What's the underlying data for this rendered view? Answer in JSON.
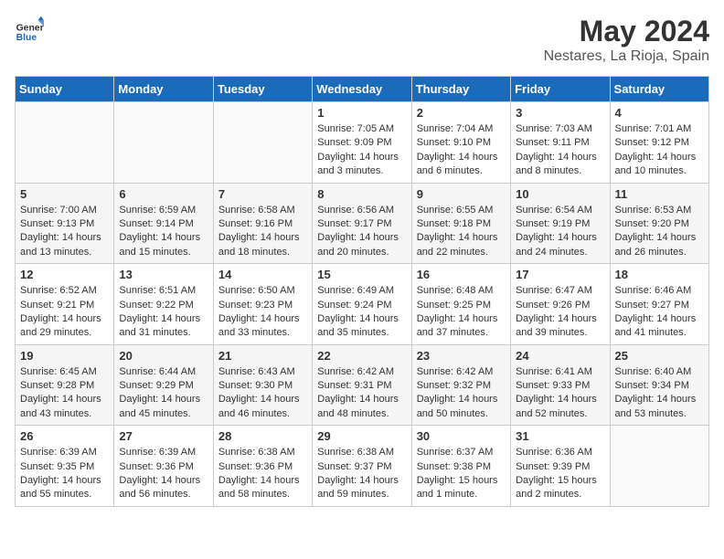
{
  "logo": {
    "text_general": "General",
    "text_blue": "Blue"
  },
  "header": {
    "title": "May 2024",
    "subtitle": "Nestares, La Rioja, Spain"
  },
  "weekdays": [
    "Sunday",
    "Monday",
    "Tuesday",
    "Wednesday",
    "Thursday",
    "Friday",
    "Saturday"
  ],
  "weeks": [
    [
      {
        "day": "",
        "sunrise": "",
        "sunset": "",
        "daylight": ""
      },
      {
        "day": "",
        "sunrise": "",
        "sunset": "",
        "daylight": ""
      },
      {
        "day": "",
        "sunrise": "",
        "sunset": "",
        "daylight": ""
      },
      {
        "day": "1",
        "sunrise": "Sunrise: 7:05 AM",
        "sunset": "Sunset: 9:09 PM",
        "daylight": "Daylight: 14 hours and 3 minutes."
      },
      {
        "day": "2",
        "sunrise": "Sunrise: 7:04 AM",
        "sunset": "Sunset: 9:10 PM",
        "daylight": "Daylight: 14 hours and 6 minutes."
      },
      {
        "day": "3",
        "sunrise": "Sunrise: 7:03 AM",
        "sunset": "Sunset: 9:11 PM",
        "daylight": "Daylight: 14 hours and 8 minutes."
      },
      {
        "day": "4",
        "sunrise": "Sunrise: 7:01 AM",
        "sunset": "Sunset: 9:12 PM",
        "daylight": "Daylight: 14 hours and 10 minutes."
      }
    ],
    [
      {
        "day": "5",
        "sunrise": "Sunrise: 7:00 AM",
        "sunset": "Sunset: 9:13 PM",
        "daylight": "Daylight: 14 hours and 13 minutes."
      },
      {
        "day": "6",
        "sunrise": "Sunrise: 6:59 AM",
        "sunset": "Sunset: 9:14 PM",
        "daylight": "Daylight: 14 hours and 15 minutes."
      },
      {
        "day": "7",
        "sunrise": "Sunrise: 6:58 AM",
        "sunset": "Sunset: 9:16 PM",
        "daylight": "Daylight: 14 hours and 18 minutes."
      },
      {
        "day": "8",
        "sunrise": "Sunrise: 6:56 AM",
        "sunset": "Sunset: 9:17 PM",
        "daylight": "Daylight: 14 hours and 20 minutes."
      },
      {
        "day": "9",
        "sunrise": "Sunrise: 6:55 AM",
        "sunset": "Sunset: 9:18 PM",
        "daylight": "Daylight: 14 hours and 22 minutes."
      },
      {
        "day": "10",
        "sunrise": "Sunrise: 6:54 AM",
        "sunset": "Sunset: 9:19 PM",
        "daylight": "Daylight: 14 hours and 24 minutes."
      },
      {
        "day": "11",
        "sunrise": "Sunrise: 6:53 AM",
        "sunset": "Sunset: 9:20 PM",
        "daylight": "Daylight: 14 hours and 26 minutes."
      }
    ],
    [
      {
        "day": "12",
        "sunrise": "Sunrise: 6:52 AM",
        "sunset": "Sunset: 9:21 PM",
        "daylight": "Daylight: 14 hours and 29 minutes."
      },
      {
        "day": "13",
        "sunrise": "Sunrise: 6:51 AM",
        "sunset": "Sunset: 9:22 PM",
        "daylight": "Daylight: 14 hours and 31 minutes."
      },
      {
        "day": "14",
        "sunrise": "Sunrise: 6:50 AM",
        "sunset": "Sunset: 9:23 PM",
        "daylight": "Daylight: 14 hours and 33 minutes."
      },
      {
        "day": "15",
        "sunrise": "Sunrise: 6:49 AM",
        "sunset": "Sunset: 9:24 PM",
        "daylight": "Daylight: 14 hours and 35 minutes."
      },
      {
        "day": "16",
        "sunrise": "Sunrise: 6:48 AM",
        "sunset": "Sunset: 9:25 PM",
        "daylight": "Daylight: 14 hours and 37 minutes."
      },
      {
        "day": "17",
        "sunrise": "Sunrise: 6:47 AM",
        "sunset": "Sunset: 9:26 PM",
        "daylight": "Daylight: 14 hours and 39 minutes."
      },
      {
        "day": "18",
        "sunrise": "Sunrise: 6:46 AM",
        "sunset": "Sunset: 9:27 PM",
        "daylight": "Daylight: 14 hours and 41 minutes."
      }
    ],
    [
      {
        "day": "19",
        "sunrise": "Sunrise: 6:45 AM",
        "sunset": "Sunset: 9:28 PM",
        "daylight": "Daylight: 14 hours and 43 minutes."
      },
      {
        "day": "20",
        "sunrise": "Sunrise: 6:44 AM",
        "sunset": "Sunset: 9:29 PM",
        "daylight": "Daylight: 14 hours and 45 minutes."
      },
      {
        "day": "21",
        "sunrise": "Sunrise: 6:43 AM",
        "sunset": "Sunset: 9:30 PM",
        "daylight": "Daylight: 14 hours and 46 minutes."
      },
      {
        "day": "22",
        "sunrise": "Sunrise: 6:42 AM",
        "sunset": "Sunset: 9:31 PM",
        "daylight": "Daylight: 14 hours and 48 minutes."
      },
      {
        "day": "23",
        "sunrise": "Sunrise: 6:42 AM",
        "sunset": "Sunset: 9:32 PM",
        "daylight": "Daylight: 14 hours and 50 minutes."
      },
      {
        "day": "24",
        "sunrise": "Sunrise: 6:41 AM",
        "sunset": "Sunset: 9:33 PM",
        "daylight": "Daylight: 14 hours and 52 minutes."
      },
      {
        "day": "25",
        "sunrise": "Sunrise: 6:40 AM",
        "sunset": "Sunset: 9:34 PM",
        "daylight": "Daylight: 14 hours and 53 minutes."
      }
    ],
    [
      {
        "day": "26",
        "sunrise": "Sunrise: 6:39 AM",
        "sunset": "Sunset: 9:35 PM",
        "daylight": "Daylight: 14 hours and 55 minutes."
      },
      {
        "day": "27",
        "sunrise": "Sunrise: 6:39 AM",
        "sunset": "Sunset: 9:36 PM",
        "daylight": "Daylight: 14 hours and 56 minutes."
      },
      {
        "day": "28",
        "sunrise": "Sunrise: 6:38 AM",
        "sunset": "Sunset: 9:36 PM",
        "daylight": "Daylight: 14 hours and 58 minutes."
      },
      {
        "day": "29",
        "sunrise": "Sunrise: 6:38 AM",
        "sunset": "Sunset: 9:37 PM",
        "daylight": "Daylight: 14 hours and 59 minutes."
      },
      {
        "day": "30",
        "sunrise": "Sunrise: 6:37 AM",
        "sunset": "Sunset: 9:38 PM",
        "daylight": "Daylight: 15 hours and 1 minute."
      },
      {
        "day": "31",
        "sunrise": "Sunrise: 6:36 AM",
        "sunset": "Sunset: 9:39 PM",
        "daylight": "Daylight: 15 hours and 2 minutes."
      },
      {
        "day": "",
        "sunrise": "",
        "sunset": "",
        "daylight": ""
      }
    ]
  ]
}
